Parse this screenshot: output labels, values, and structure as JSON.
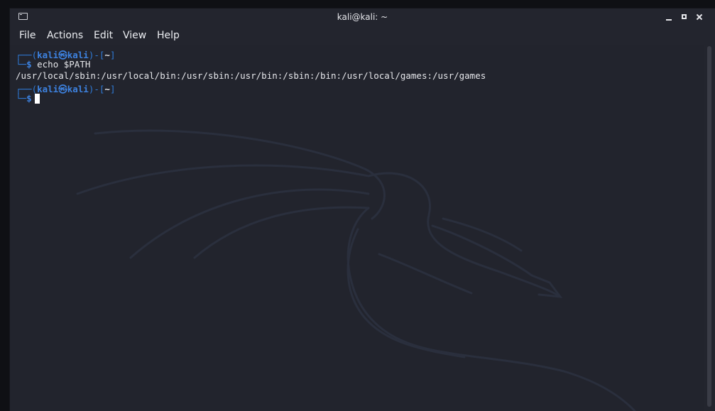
{
  "window": {
    "title": "kali@kali: ~"
  },
  "menubar": {
    "file": "File",
    "actions": "Actions",
    "edit": "Edit",
    "view": "View",
    "help": "Help"
  },
  "terminal": {
    "prompt1": {
      "corner_top": "┌──(",
      "user": "kali",
      "at_symbol": "㉿",
      "host": "kali",
      "bracket_mid": ")-[",
      "dir": "~",
      "bracket_end": "]",
      "corner_bottom": "└─",
      "dollar": "$",
      "command": " echo $PATH"
    },
    "output": "/usr/local/sbin:/usr/local/bin:/usr/sbin:/usr/bin:/sbin:/bin:/usr/local/games:/usr/games",
    "prompt2": {
      "corner_top": "┌──(",
      "user": "kali",
      "at_symbol": "㉿",
      "host": "kali",
      "bracket_mid": ")-[",
      "dir": "~",
      "bracket_end": "]",
      "corner_bottom": "└─",
      "dollar": "$"
    }
  },
  "colors": {
    "background": "#22242d",
    "prompt_blue": "#2f7bd8",
    "text": "#e6e7eb"
  }
}
